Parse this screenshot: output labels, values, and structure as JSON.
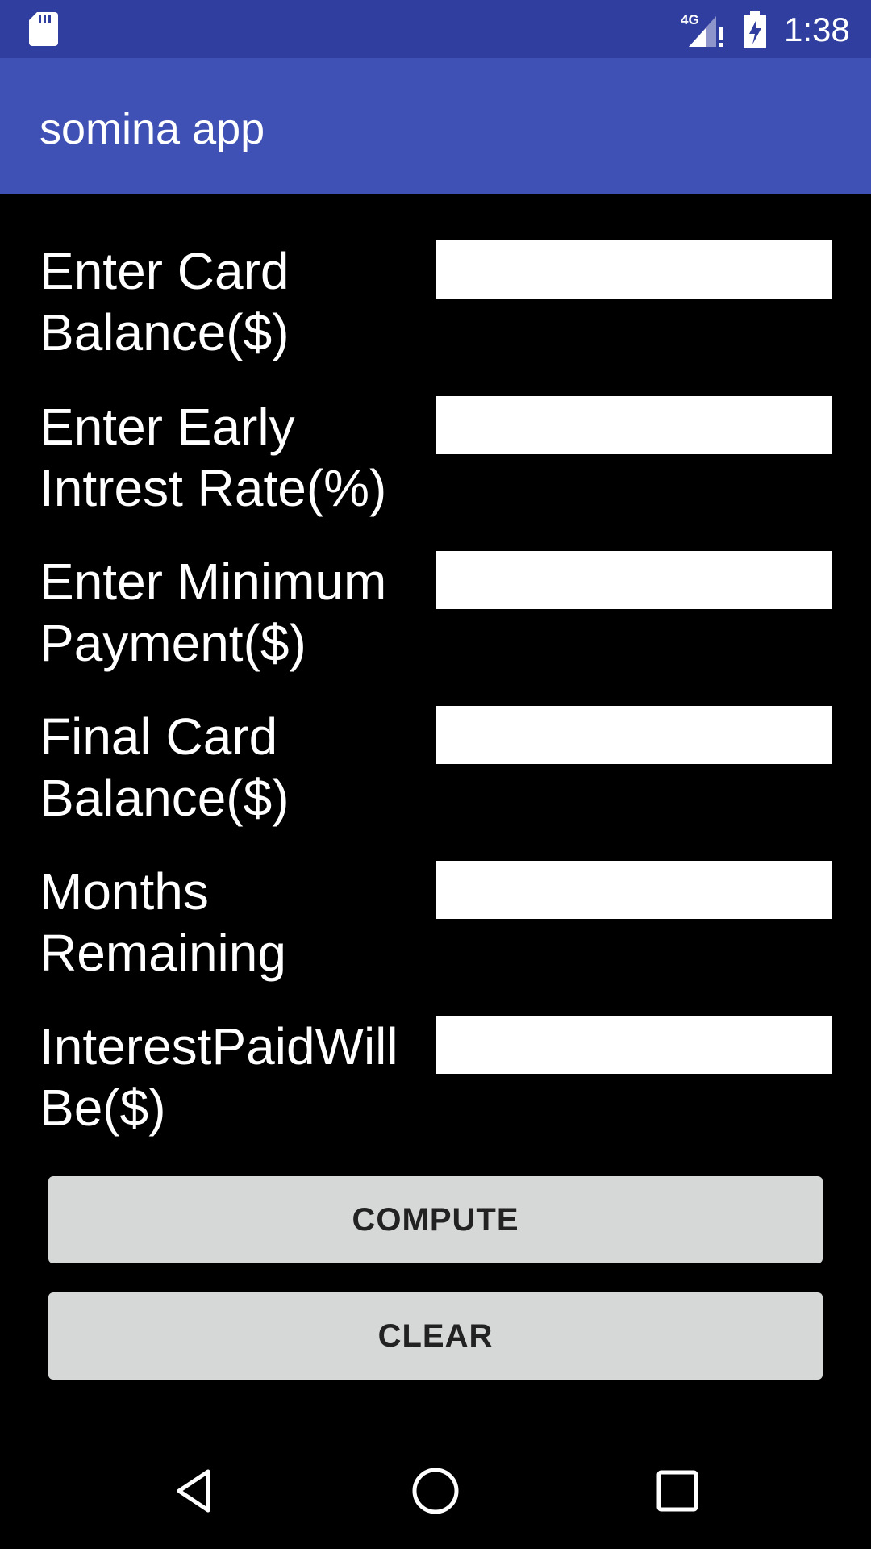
{
  "status_bar": {
    "time": "1:38",
    "network": "4G",
    "icons": [
      "sd-card-icon",
      "signal-icon",
      "battery-charging-icon"
    ]
  },
  "app_bar": {
    "title": "somina app",
    "color": "#3f51b5"
  },
  "form": {
    "fields": [
      {
        "label": "Enter Card\nBalance($)",
        "value": ""
      },
      {
        "label": "Enter Early\nIntrest Rate(%)",
        "value": ""
      },
      {
        "label": "Enter Minimum\nPayment($)",
        "value": ""
      },
      {
        "label": "Final Card\nBalance($)",
        "value": ""
      },
      {
        "label": "Months\nRemaining",
        "value": ""
      },
      {
        "label": "InterestPaidWill\nBe($)",
        "value": ""
      }
    ]
  },
  "buttons": {
    "compute_label": "COMPUTE",
    "clear_label": "CLEAR"
  },
  "nav_bar": {
    "icons": [
      "back-icon",
      "home-icon",
      "recents-icon"
    ]
  },
  "colors": {
    "status_bar": "#303f9f",
    "app_bar": "#3f51b5",
    "background": "#000000",
    "button": "#d6d7d7"
  }
}
